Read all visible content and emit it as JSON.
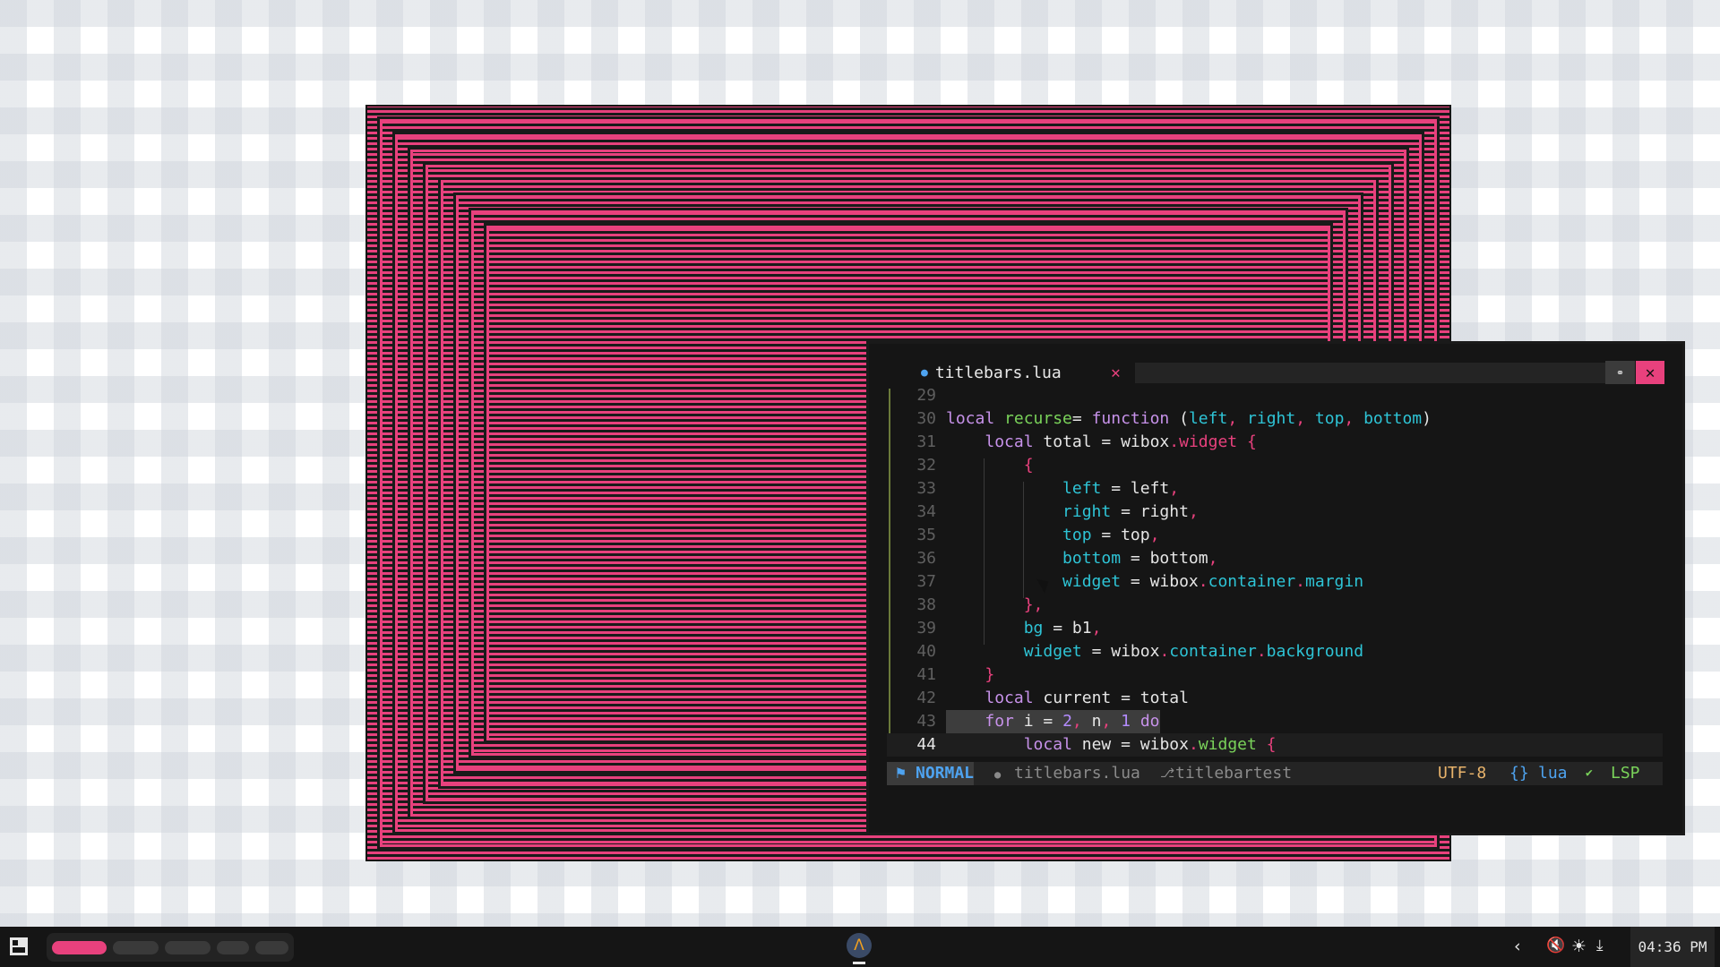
{
  "editor": {
    "tab": {
      "icon": "lua-file-icon",
      "filename": "titlebars.lua",
      "close_glyph": "✕"
    },
    "window_buttons": {
      "minimize_glyph": "⚭",
      "close_glyph": "✕"
    },
    "lines": [
      {
        "n": "29",
        "tokens": []
      },
      {
        "n": "30",
        "tokens": [
          [
            "kw",
            "local "
          ],
          [
            "fn",
            "recurse"
          ],
          [
            "",
            "= "
          ],
          [
            "kw",
            "function "
          ],
          [
            "",
            "("
          ],
          [
            "pr",
            "left"
          ],
          [
            "pk",
            ", "
          ],
          [
            "pr",
            "right"
          ],
          [
            "pk",
            ", "
          ],
          [
            "pr",
            "top"
          ],
          [
            "pk",
            ", "
          ],
          [
            "pr",
            "bottom"
          ],
          [
            "",
            ")"
          ]
        ]
      },
      {
        "n": "31",
        "tokens": [
          [
            "",
            "    "
          ],
          [
            "kw",
            "local "
          ],
          [
            "",
            "total = wibox"
          ],
          [
            "pk",
            "."
          ],
          [
            "pk",
            "widget "
          ],
          [
            "pk",
            "{"
          ]
        ]
      },
      {
        "n": "32",
        "tokens": [
          [
            "",
            "        "
          ],
          [
            "pk",
            "{"
          ]
        ]
      },
      {
        "n": "33",
        "tokens": [
          [
            "",
            "            "
          ],
          [
            "pr",
            "left"
          ],
          [
            "",
            " = left"
          ],
          [
            "pk",
            ","
          ]
        ]
      },
      {
        "n": "34",
        "tokens": [
          [
            "",
            "            "
          ],
          [
            "pr",
            "right"
          ],
          [
            "",
            " = right"
          ],
          [
            "pk",
            ","
          ]
        ]
      },
      {
        "n": "35",
        "tokens": [
          [
            "",
            "            "
          ],
          [
            "pr",
            "top"
          ],
          [
            "",
            " = top"
          ],
          [
            "pk",
            ","
          ]
        ]
      },
      {
        "n": "36",
        "tokens": [
          [
            "",
            "            "
          ],
          [
            "pr",
            "bottom"
          ],
          [
            "",
            " = bottom"
          ],
          [
            "pk",
            ","
          ]
        ]
      },
      {
        "n": "37",
        "tokens": [
          [
            "",
            "            "
          ],
          [
            "pr",
            "widget"
          ],
          [
            "",
            " = wibox"
          ],
          [
            "pk",
            "."
          ],
          [
            "pr",
            "container"
          ],
          [
            "pk",
            "."
          ],
          [
            "pr",
            "margin"
          ]
        ]
      },
      {
        "n": "38",
        "tokens": [
          [
            "",
            "        "
          ],
          [
            "pk",
            "},"
          ]
        ]
      },
      {
        "n": "39",
        "tokens": [
          [
            "",
            "        "
          ],
          [
            "pr",
            "bg"
          ],
          [
            "",
            " = b1"
          ],
          [
            "pk",
            ","
          ]
        ]
      },
      {
        "n": "40",
        "tokens": [
          [
            "",
            "        "
          ],
          [
            "pr",
            "widget"
          ],
          [
            "",
            " = wibox"
          ],
          [
            "pk",
            "."
          ],
          [
            "pr",
            "container"
          ],
          [
            "pk",
            "."
          ],
          [
            "pr",
            "background"
          ]
        ]
      },
      {
        "n": "41",
        "tokens": [
          [
            "",
            "    "
          ],
          [
            "pk",
            "}"
          ]
        ]
      },
      {
        "n": "42",
        "tokens": [
          [
            "",
            "    "
          ],
          [
            "kw",
            "local "
          ],
          [
            "",
            "current = total"
          ]
        ]
      },
      {
        "n": "43",
        "tokens": [
          [
            "",
            "    "
          ],
          [
            "kw",
            "for "
          ],
          [
            "",
            "i = "
          ],
          [
            "nm",
            "2"
          ],
          [
            "pk",
            ", "
          ],
          [
            "",
            "n"
          ],
          [
            "pk",
            ", "
          ],
          [
            "nm",
            "1 "
          ],
          [
            "kw",
            "do"
          ]
        ]
      },
      {
        "n": "44",
        "tokens": [
          [
            "",
            "    "
          ],
          [
            "",
            "    "
          ],
          [
            "kw",
            "local "
          ],
          [
            "",
            "new = wibox"
          ],
          [
            "pk",
            "."
          ],
          [
            "fn",
            "widget "
          ],
          [
            "pk",
            "{"
          ]
        ]
      }
    ],
    "status": {
      "mode_icon": "vim-icon",
      "mode": "NORMAL",
      "file_icon": "lua-file-icon",
      "file": "titlebars.lua",
      "branch_icon": "git-branch-icon",
      "branch": "titlebartest",
      "encoding": "UTF-8",
      "filetype_icon": "{}",
      "filetype": "lua",
      "lsp_icon": "check-icon",
      "lsp": "LSP"
    }
  },
  "taskbar": {
    "clock": "04:36 PM",
    "launcher_icon": "arch-linux-icon",
    "tray": [
      "chevron-left-icon",
      "mute-icon",
      "brightness-icon",
      "download-icon"
    ]
  },
  "colors": {
    "accent": "#e8417d",
    "bg": "#151515",
    "blue": "#4ea3f0",
    "green": "#7ad35a",
    "cyan": "#2ec4d6"
  }
}
